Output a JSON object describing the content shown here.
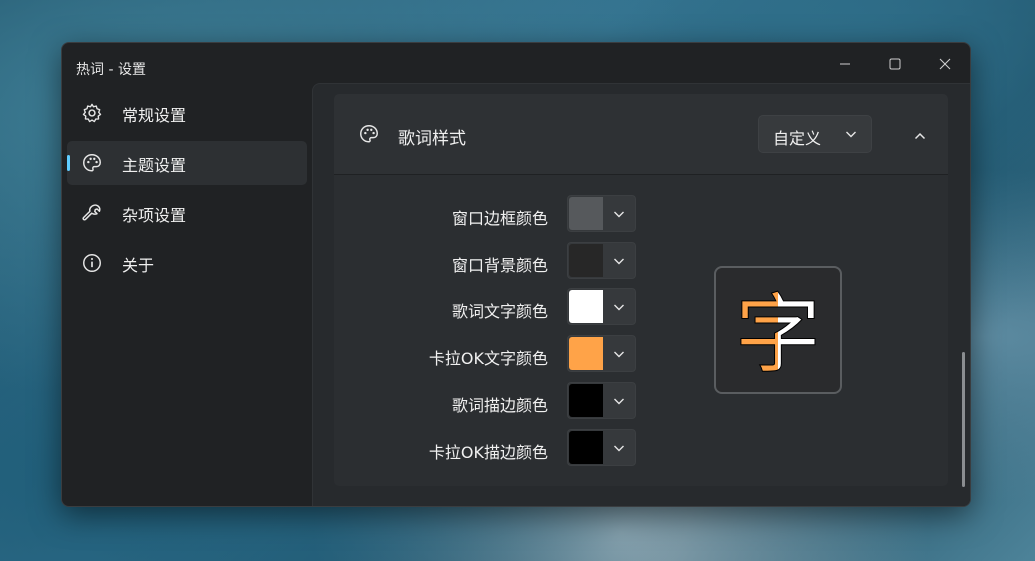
{
  "window": {
    "title": "热词 - 设置"
  },
  "sidebar": {
    "items": [
      {
        "label": "常规设置",
        "icon": "gear-icon",
        "selected": false
      },
      {
        "label": "主题设置",
        "icon": "palette-icon",
        "selected": true
      },
      {
        "label": "杂项设置",
        "icon": "wrench-icon",
        "selected": false
      },
      {
        "label": "关于",
        "icon": "info-icon",
        "selected": false
      }
    ]
  },
  "lyrics_style": {
    "title": "歌词样式",
    "icon": "palette-icon",
    "preset": "自定义",
    "rows": [
      {
        "label": "窗口边框颜色",
        "color": "#56595c"
      },
      {
        "label": "窗口背景颜色",
        "color": "#272727"
      },
      {
        "label": "歌词文字颜色",
        "color": "#ffffff"
      },
      {
        "label": "卡拉OK文字颜色",
        "color": "#ffa348"
      },
      {
        "label": "歌词描边颜色",
        "color": "#000000"
      },
      {
        "label": "卡拉OK描边颜色",
        "color": "#000000"
      }
    ],
    "preview_char": "字"
  },
  "colors": {
    "accent": "#60cdff",
    "karaoke": "#ffa348",
    "text": "#ffffff"
  }
}
